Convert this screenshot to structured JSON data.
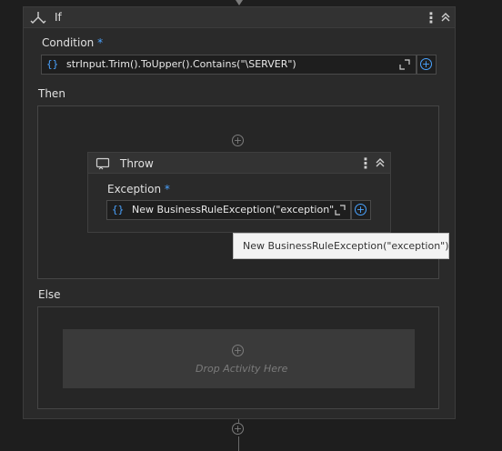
{
  "if_activity": {
    "title": "If",
    "condition_label": "Condition",
    "required_mark": "*",
    "condition_expression": "strInput.Trim().ToUpper().Contains(\"\\SERVER\")",
    "then_label": "Then",
    "else_label": "Else"
  },
  "throw_activity": {
    "title": "Throw",
    "exception_label": "Exception",
    "required_mark": "*",
    "exception_expression": "New BusinessRuleException(\"exception\""
  },
  "tooltip_text": "New BusinessRuleException(\"exception\")",
  "drop_zone_text": "Drop Activity Here",
  "icons": {
    "if": "if-branch-icon",
    "throw": "throw-icon",
    "menu": "kebab-menu-icon",
    "collapse": "collapse-chevrons-icon",
    "expression": "curly-braces-icon",
    "expand_editor": "expand-editor-icon",
    "add_variable": "plus-circle-icon",
    "add_activity": "add-activity-icon"
  },
  "colors": {
    "accent": "#4aa3ff",
    "background": "#1e1e1e",
    "card": "#2a2a2a"
  }
}
